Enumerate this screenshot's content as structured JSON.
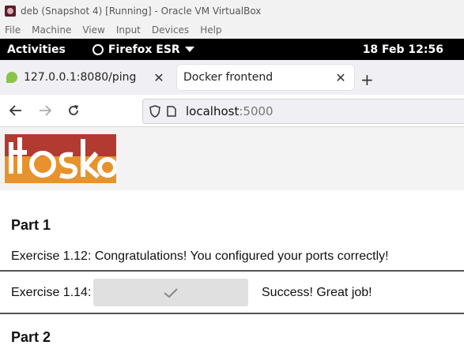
{
  "window": {
    "title": "deb (Snapshot 4) [Running] - Oracle VM VirtualBox"
  },
  "vb_menu": {
    "items": [
      "File",
      "Machine",
      "View",
      "Input",
      "Devices",
      "Help"
    ]
  },
  "gnome_bar": {
    "activities": "Activities",
    "app": "Firefox ESR",
    "datetime": "18 Feb  12:56"
  },
  "tabs": [
    {
      "title": "127.0.0.1:8080/ping",
      "favicon": "leaf-icon",
      "close": "✕"
    },
    {
      "title": "Docker frontend",
      "close": "✕",
      "active": true
    }
  ],
  "new_tab_label": "+",
  "address": {
    "host": "localhost",
    "port": ":5000"
  },
  "page": {
    "part1_heading": "Part 1",
    "ex112_text": "Exercise 1.12: Congratulations! You configured your ports correctly!",
    "ex114_label": "Exercise 1.14:",
    "ex114_button_icon": "checkmark-icon",
    "ex114_result": "Success! Great job!",
    "part2_heading": "Part 2"
  },
  "colors": {
    "logo_red": "#b23a30",
    "logo_orange": "#e8922c",
    "logo_light_orange": "#e89a2c"
  }
}
